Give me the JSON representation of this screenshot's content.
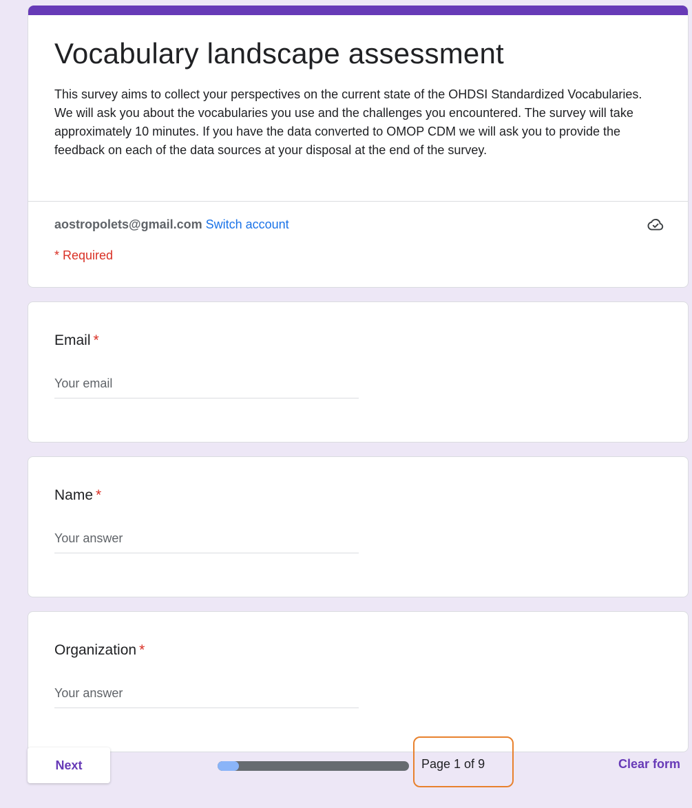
{
  "form": {
    "title": "Vocabulary landscape assessment",
    "description": "This survey aims to collect your perspectives on the current state of the OHDSI Standardized Vocabularies. We will ask you about the vocabularies you use and the challenges you encountered. The survey will take approximately 10 minutes. If you have the data converted to OMOP CDM we will ask you to provide the feedback on each of the data sources at your disposal at the end of the survey.",
    "account_email": "aostropolets@gmail.com",
    "switch_account_label": "Switch account",
    "required_note": "* Required",
    "accent_color": "#673ab7",
    "cloud_icon": "cloud-check-icon"
  },
  "questions": [
    {
      "label": "Email",
      "required_mark": "*",
      "placeholder": "Your email",
      "value": ""
    },
    {
      "label": "Name",
      "required_mark": "*",
      "placeholder": "Your answer",
      "value": ""
    },
    {
      "label": "Organization",
      "required_mark": "*",
      "placeholder": "Your answer",
      "value": ""
    }
  ],
  "footer": {
    "next_label": "Next",
    "progress": {
      "current_page": 1,
      "total_pages": 9,
      "fraction": 0.111
    },
    "page_label": "Page 1 of 9",
    "clear_label": "Clear form",
    "highlight_color": "#e8812d"
  }
}
